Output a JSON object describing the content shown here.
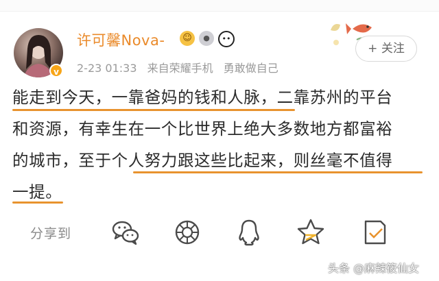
{
  "post": {
    "author": {
      "name": "许可馨Nova-",
      "badges": [
        "emoji-face-icon",
        "medal-icon",
        "panda-icon"
      ]
    },
    "timestamp": "2-23 01:33",
    "source": "来自荣耀手机",
    "signature": "勇敢做自己",
    "follow_label": "+ 关注",
    "text_lines": [
      "能走到今天，一靠爸妈的钱和人脉，二靠苏州的平台",
      "和资源，有幸生在一个比世界上绝大多数地方都富裕",
      "的城市，至于个人努力跟这些比起来，则丝毫不值得",
      "一提。"
    ]
  },
  "share_bar": {
    "label": "分享到",
    "targets": [
      "wechat-icon",
      "moments-icon",
      "qq-icon",
      "qzone-icon",
      "save-icon"
    ]
  },
  "watermark": "头条 @麻辣筱仙女",
  "colors": {
    "accent": "#e8932e",
    "username": "#ea8a2a",
    "share_icon": "#4a4a4a",
    "text": "#2b2b2b"
  }
}
